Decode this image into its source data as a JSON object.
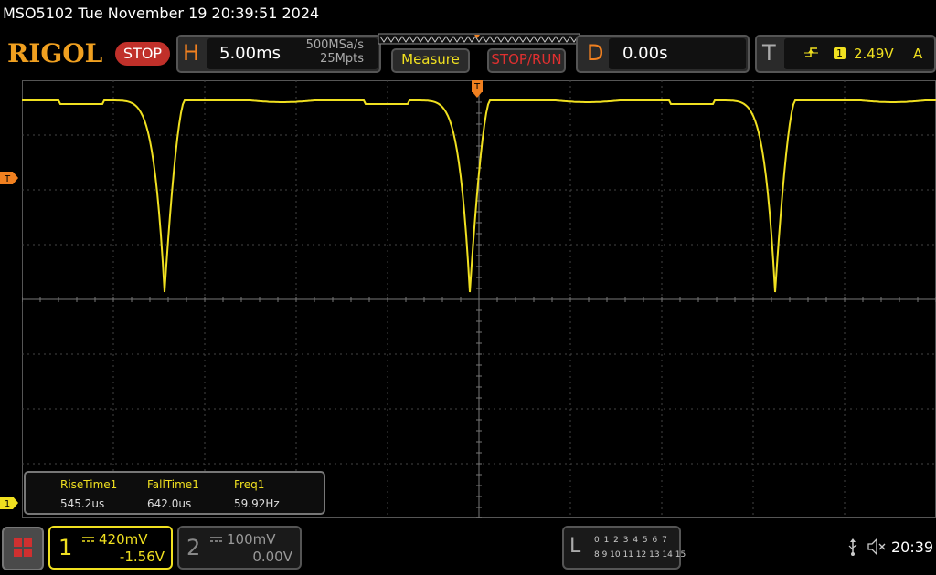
{
  "title_bar": {
    "text": "MSO5102  Tue November 19 20:39:51 2024"
  },
  "brand": {
    "logo": "RIGOL",
    "run_state": "STOP"
  },
  "horizontal": {
    "letter": "H",
    "timebase": "5.00ms",
    "sample_rate": "500MSa/s",
    "memory_depth": "25Mpts"
  },
  "buttons": {
    "measure": "Measure",
    "stop_run": "STOP/RUN"
  },
  "delay": {
    "letter": "D",
    "value": "0.00s"
  },
  "trigger": {
    "letter": "T",
    "edge_icon": "rising-edge-icon",
    "source": "1",
    "level": "2.49V",
    "coupling": "A"
  },
  "markers": {
    "trigger_top": "T",
    "trigger_left": "T",
    "channel1_left": "1"
  },
  "measurements": [
    {
      "label": "RiseTime1",
      "value": "545.2us"
    },
    {
      "label": "FallTime1",
      "value": "642.0us"
    },
    {
      "label": "Freq1",
      "value": "59.92Hz"
    }
  ],
  "channel1": {
    "number": "1",
    "scale": "420mV",
    "offset": "-1.56V",
    "color": "#f0e020"
  },
  "channel2": {
    "number": "2",
    "scale": "100mV",
    "offset": "0.00V",
    "color": "#888888"
  },
  "logic": {
    "letter": "L",
    "row1": "0 1 2 3  4 5 6 7",
    "row2": "8 9 10 11 12 13 14 15"
  },
  "status": {
    "usb_icon": "usb-icon",
    "speaker_icon": "speaker-muted-icon",
    "clock": "20:39"
  },
  "colors": {
    "trace": "#f0e020",
    "accent": "#f08020",
    "stop": "#c0302a"
  }
}
